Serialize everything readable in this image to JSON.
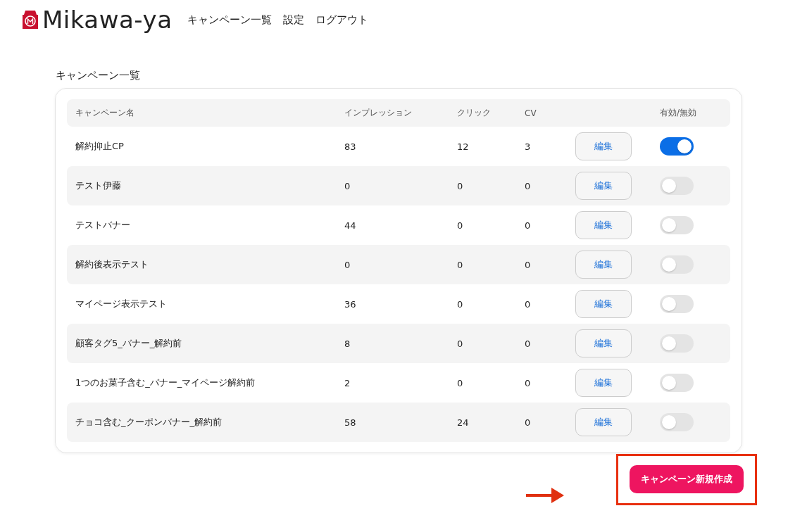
{
  "header": {
    "logo": "Mikawa-ya",
    "nav": [
      "キャンペーン一覧",
      "設定",
      "ログアウト"
    ]
  },
  "page_title": "キャンペーン一覧",
  "table": {
    "columns": [
      "キャンペーン名",
      "インプレッション",
      "クリック",
      "CV",
      "有効/無効"
    ],
    "rows": [
      {
        "name": "解約抑止CP",
        "impressions": "83",
        "clicks": "12",
        "cv": "3",
        "edit": "編集",
        "on": true
      },
      {
        "name": "テスト伊藤",
        "impressions": "0",
        "clicks": "0",
        "cv": "0",
        "edit": "編集",
        "on": false
      },
      {
        "name": "テストバナー",
        "impressions": "44",
        "clicks": "0",
        "cv": "0",
        "edit": "編集",
        "on": false
      },
      {
        "name": "解約後表示テスト",
        "impressions": "0",
        "clicks": "0",
        "cv": "0",
        "edit": "編集",
        "on": false
      },
      {
        "name": "マイページ表示テスト",
        "impressions": "36",
        "clicks": "0",
        "cv": "0",
        "edit": "編集",
        "on": false
      },
      {
        "name": "顧客タグ5_バナー_解約前",
        "impressions": "8",
        "clicks": "0",
        "cv": "0",
        "edit": "編集",
        "on": false
      },
      {
        "name": "1つのお菓子含む_バナー_マイページ解約前",
        "impressions": "2",
        "clicks": "0",
        "cv": "0",
        "edit": "編集",
        "on": false
      },
      {
        "name": "チョコ含む_クーポンバナー_解約前",
        "impressions": "58",
        "clicks": "24",
        "cv": "0",
        "edit": "編集",
        "on": false
      }
    ]
  },
  "create_button": "キャンペーン新規作成"
}
